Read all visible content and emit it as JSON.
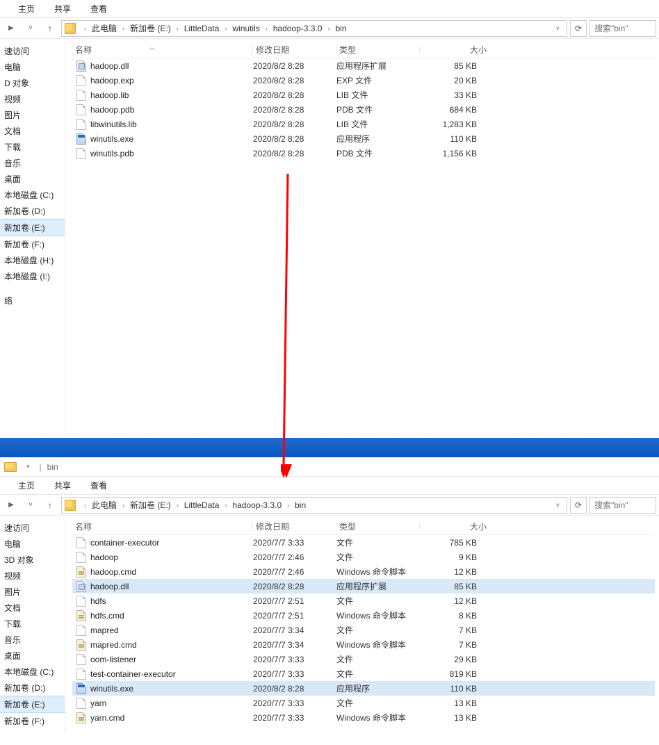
{
  "ribbon": {
    "tabs": [
      "主页",
      "共享",
      "查看"
    ]
  },
  "top": {
    "breadcrumbs": [
      "此电脑",
      "新加卷 (E:)",
      "LittleData",
      "winutils",
      "hadoop-3.3.0",
      "bin"
    ],
    "searchPlaceholder": "搜索\"bin\"",
    "columns": {
      "name": "名称",
      "date": "修改日期",
      "type": "类型",
      "size": "大小"
    },
    "sidebar": {
      "items": [
        "速访问",
        "电脑",
        "D 对象",
        "视频",
        "图片",
        "文档",
        "下载",
        "音乐",
        "桌面",
        "本地磁盘 (C:)",
        "新加卷 (D:)",
        "新加卷 (E:)",
        "新加卷 (F:)",
        "本地磁盘 (H:)",
        "本地磁盘 (I:)"
      ],
      "activeIndex": 11,
      "footer": "络"
    },
    "files": [
      {
        "icon": "dll",
        "name": "hadoop.dll",
        "date": "2020/8/2 8:28",
        "type": "应用程序扩展",
        "size": "85 KB"
      },
      {
        "icon": "file",
        "name": "hadoop.exp",
        "date": "2020/8/2 8:28",
        "type": "EXP 文件",
        "size": "20 KB"
      },
      {
        "icon": "file",
        "name": "hadoop.lib",
        "date": "2020/8/2 8:28",
        "type": "LIB 文件",
        "size": "33 KB"
      },
      {
        "icon": "file",
        "name": "hadoop.pdb",
        "date": "2020/8/2 8:28",
        "type": "PDB 文件",
        "size": "684 KB"
      },
      {
        "icon": "file",
        "name": "libwinutils.lib",
        "date": "2020/8/2 8:28",
        "type": "LIB 文件",
        "size": "1,283 KB"
      },
      {
        "icon": "exe",
        "name": "winutils.exe",
        "date": "2020/8/2 8:28",
        "type": "应用程序",
        "size": "110 KB"
      },
      {
        "icon": "file",
        "name": "winutils.pdb",
        "date": "2020/8/2 8:28",
        "type": "PDB 文件",
        "size": "1,156 KB"
      }
    ]
  },
  "bottom": {
    "title": "bin",
    "breadcrumbs": [
      "此电脑",
      "新加卷 (E:)",
      "LittleData",
      "hadoop-3.3.0",
      "bin"
    ],
    "searchPlaceholder": "搜索\"bin\"",
    "columns": {
      "name": "名称",
      "date": "修改日期",
      "type": "类型",
      "size": "大小"
    },
    "sidebar": {
      "items": [
        "速访问",
        "电脑",
        "3D 对象",
        "视频",
        "图片",
        "文档",
        "下载",
        "音乐",
        "桌面",
        "本地磁盘 (C:)",
        "新加卷 (D:)",
        "新加卷 (E:)",
        "新加卷 (F:)"
      ],
      "activeIndex": 11
    },
    "files": [
      {
        "icon": "file",
        "name": "container-executor",
        "date": "2020/7/7 3:33",
        "type": "文件",
        "size": "785 KB",
        "sel": false
      },
      {
        "icon": "file",
        "name": "hadoop",
        "date": "2020/7/7 2:46",
        "type": "文件",
        "size": "9 KB",
        "sel": false
      },
      {
        "icon": "cmd",
        "name": "hadoop.cmd",
        "date": "2020/7/7 2:46",
        "type": "Windows 命令脚本",
        "size": "12 KB",
        "sel": false
      },
      {
        "icon": "dll",
        "name": "hadoop.dll",
        "date": "2020/8/2 8:28",
        "type": "应用程序扩展",
        "size": "85 KB",
        "sel": true
      },
      {
        "icon": "file",
        "name": "hdfs",
        "date": "2020/7/7 2:51",
        "type": "文件",
        "size": "12 KB",
        "sel": false
      },
      {
        "icon": "cmd",
        "name": "hdfs.cmd",
        "date": "2020/7/7 2:51",
        "type": "Windows 命令脚本",
        "size": "8 KB",
        "sel": false
      },
      {
        "icon": "file",
        "name": "mapred",
        "date": "2020/7/7 3:34",
        "type": "文件",
        "size": "7 KB",
        "sel": false
      },
      {
        "icon": "cmd",
        "name": "mapred.cmd",
        "date": "2020/7/7 3:34",
        "type": "Windows 命令脚本",
        "size": "7 KB",
        "sel": false
      },
      {
        "icon": "file",
        "name": "oom-listener",
        "date": "2020/7/7 3:33",
        "type": "文件",
        "size": "29 KB",
        "sel": false
      },
      {
        "icon": "file",
        "name": "test-container-executor",
        "date": "2020/7/7 3:33",
        "type": "文件",
        "size": "819 KB",
        "sel": false
      },
      {
        "icon": "exe",
        "name": "winutils.exe",
        "date": "2020/8/2 8:28",
        "type": "应用程序",
        "size": "110 KB",
        "sel": true
      },
      {
        "icon": "file",
        "name": "yarn",
        "date": "2020/7/7 3:33",
        "type": "文件",
        "size": "13 KB",
        "sel": false
      },
      {
        "icon": "cmd",
        "name": "yarn.cmd",
        "date": "2020/7/7 3:33",
        "type": "Windows 命令脚本",
        "size": "13 KB",
        "sel": false
      }
    ]
  }
}
